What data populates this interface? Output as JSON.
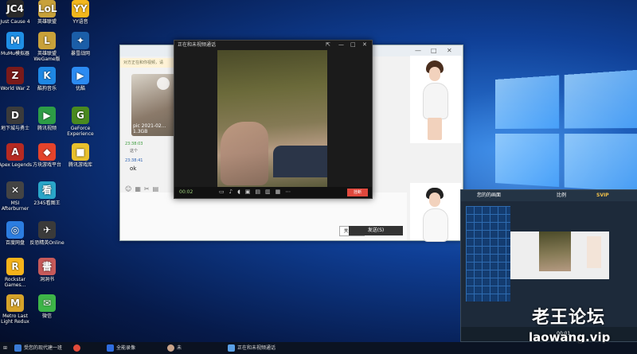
{
  "desktop_icons": [
    {
      "label": "Just Cause 4",
      "glyph": "JC4",
      "color": "#2a2a2a"
    },
    {
      "label": "英雄联盟",
      "glyph": "LoL",
      "color": "#c8a13a"
    },
    {
      "label": "YY语音",
      "glyph": "YY",
      "color": "#f3b71d"
    },
    {
      "label": "MuMu模拟器",
      "glyph": "M",
      "color": "#1f8fe6"
    },
    {
      "label": "英雄联盟WeGame版",
      "glyph": "L",
      "color": "#c8a13a"
    },
    {
      "label": "暴雪战网",
      "glyph": "✦",
      "color": "#1b5ea8"
    },
    {
      "label": "World War Z",
      "glyph": "Z",
      "color": "#7a1a1a"
    },
    {
      "label": "酷狗音乐",
      "glyph": "K",
      "color": "#1e88e5"
    },
    {
      "label": "优酷",
      "glyph": "▶",
      "color": "#2c8bf2"
    },
    {
      "label": "地下城与勇士",
      "glyph": "D",
      "color": "#3b3b3b"
    },
    {
      "label": "腾讯视频",
      "glyph": "▶",
      "color": "#2d9d46"
    },
    {
      "label": "GeForce Experience",
      "glyph": "G",
      "color": "#4a8a1f"
    },
    {
      "label": "Apex Legends",
      "glyph": "A",
      "color": "#b62a22"
    },
    {
      "label": "方块游戏平台",
      "glyph": "◆",
      "color": "#e4432b"
    },
    {
      "label": "腾讯游戏库",
      "glyph": "■",
      "color": "#e8c02d"
    },
    {
      "label": "MSI Afterburner",
      "glyph": "✕",
      "color": "#444"
    },
    {
      "label": "2345看图王",
      "glyph": "看",
      "color": "#2aa6c9"
    },
    {
      "label": "百度网盘",
      "glyph": "◎",
      "color": "#2c7de0"
    },
    {
      "label": "反恐精英Online",
      "glyph": "✈",
      "color": "#3a3a3a"
    },
    {
      "label": "Rockstar Games...",
      "glyph": "R",
      "color": "#f6b31a"
    },
    {
      "label": "洞洞书",
      "glyph": "書",
      "color": "#c75a5a"
    },
    {
      "label": "Metro Last Light Redux",
      "glyph": "M",
      "color": "#d6a32a"
    },
    {
      "label": "微信",
      "glyph": "✉",
      "color": "#3eb548"
    }
  ],
  "chat_window": {
    "notice": "对方正在和你视频，请",
    "thumb_label": "pic 2021-02...",
    "thumb_size": "1.3GB",
    "msg1_time": "23:38:03",
    "msg1_text": "这个",
    "msg2_time": "23:38:41",
    "msg2_text": "ok",
    "close_label": "关闭(C)",
    "send_label": "发送(S)"
  },
  "video_window": {
    "title": "正在和未视频通话",
    "timer": "00:02",
    "hangup": "挂断"
  },
  "live_overlay": {
    "title": "您的的画面",
    "mode": "比例",
    "brand": "SVIP",
    "timer": "00:01"
  },
  "watermark": {
    "cn": "老王论坛",
    "site": "laowang.vip"
  },
  "taskbar": {
    "item1": "受您的现代建一班",
    "item2": "全能录像",
    "item3": "未",
    "item4": "正在和未视频通话"
  }
}
